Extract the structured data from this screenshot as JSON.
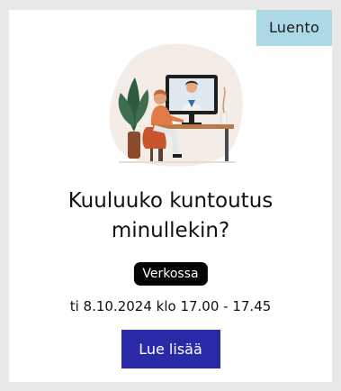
{
  "card": {
    "type_badge": "Luento",
    "title_line1": "Kuuluuko kuntoutus",
    "title_line2": "minullekin?",
    "format_badge": "Verkossa",
    "datetime": "ti 8.10.2024 klo 17.00 - 17.45",
    "cta_label": "Lue lisää"
  },
  "colors": {
    "page_background": "#e8e8e8",
    "type_badge_bg": "#add8e6",
    "format_badge_bg": "#050505",
    "cta_bg": "#2a2aa8"
  },
  "icons": {
    "illustration": "video-call-illustration"
  }
}
